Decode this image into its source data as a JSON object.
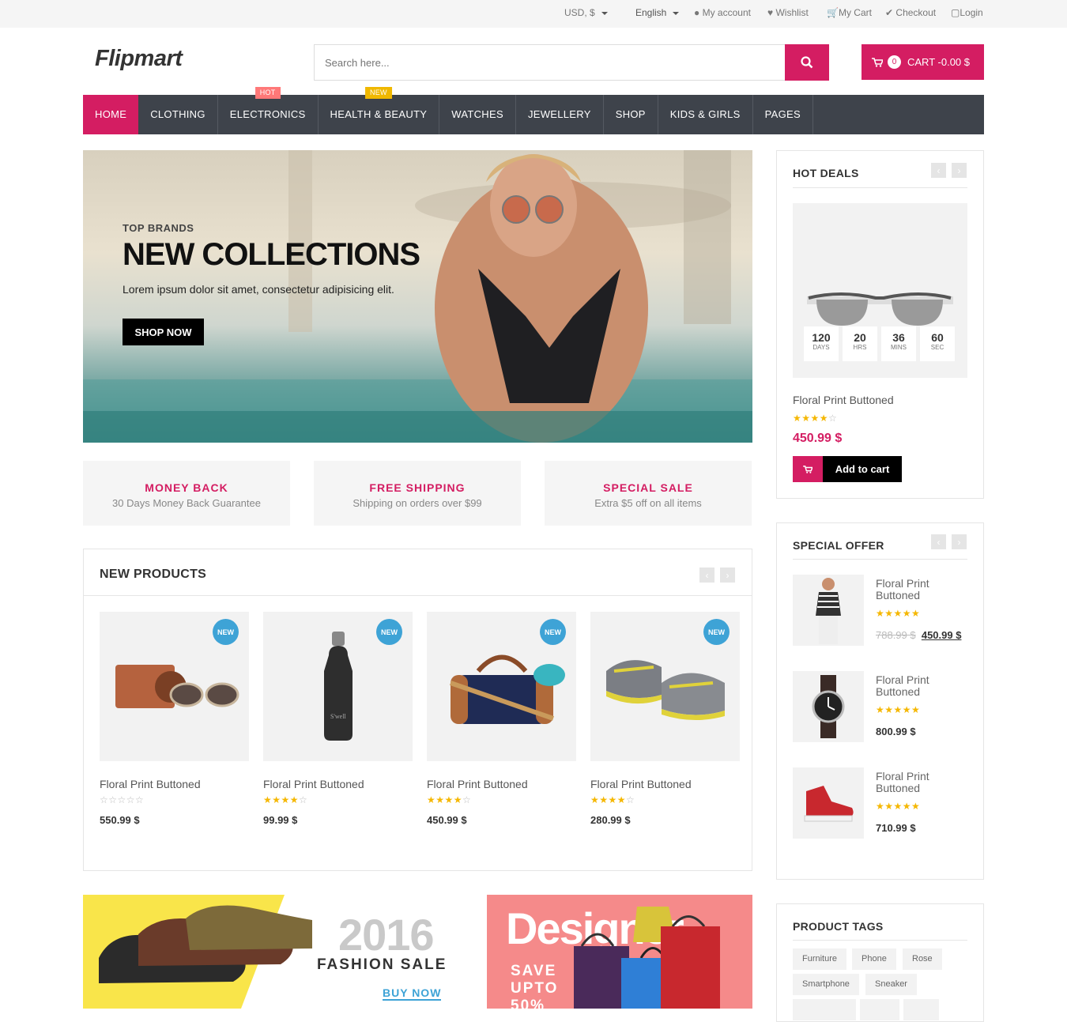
{
  "topbar": {
    "currency": "USD, $",
    "language": "English",
    "my_account": "My account",
    "wishlist": "Wishlist",
    "my_cart": "My Cart",
    "checkout": "Checkout",
    "login": "Login"
  },
  "header": {
    "logo": "Flipmart",
    "search_placeholder": "Search here...",
    "cart_count": "0",
    "cart_label": "CART -0.00 $"
  },
  "nav": {
    "items": [
      {
        "label": "HOME"
      },
      {
        "label": "CLOTHING"
      },
      {
        "label": "ELECTRONICS",
        "badge": "HOT"
      },
      {
        "label": "HEALTH & BEAUTY",
        "badge": "NEW"
      },
      {
        "label": "WATCHES"
      },
      {
        "label": "JEWELLERY"
      },
      {
        "label": "SHOP"
      },
      {
        "label": "KIDS & GIRLS"
      },
      {
        "label": "PAGES"
      }
    ]
  },
  "hero": {
    "kicker": "TOP BRANDS",
    "title": "NEW COLLECTIONS",
    "subtitle": "Lorem ipsum dolor sit amet, consectetur adipisicing elit.",
    "button": "SHOP NOW"
  },
  "features": [
    {
      "title": "MONEY BACK",
      "sub": "30 Days Money Back Guarantee"
    },
    {
      "title": "FREE SHIPPING",
      "sub": "Shipping on orders over $99"
    },
    {
      "title": "SPECIAL SALE",
      "sub": "Extra $5 off on all items"
    }
  ],
  "new_products": {
    "title": "NEW PRODUCTS",
    "badge": "NEW",
    "items": [
      {
        "name": "Floral Print Buttoned",
        "rating": 0,
        "price": "550.99 $"
      },
      {
        "name": "Floral Print Buttoned",
        "rating": 4,
        "price": "99.99 $"
      },
      {
        "name": "Floral Print Buttoned",
        "rating": 4,
        "price": "450.99 $"
      },
      {
        "name": "Floral Print Buttoned",
        "rating": 4,
        "price": "280.99 $"
      }
    ]
  },
  "hot_deals": {
    "title": "HOT DEALS",
    "countdown": [
      {
        "n": "120",
        "l": "DAYS"
      },
      {
        "n": "20",
        "l": "HRS"
      },
      {
        "n": "36",
        "l": "MINS"
      },
      {
        "n": "60",
        "l": "SEC"
      }
    ],
    "name": "Floral Print Buttoned",
    "rating": 4,
    "price": "450.99 $",
    "add_to_cart": "Add to cart"
  },
  "special_offer": {
    "title": "SPECIAL OFFER",
    "items": [
      {
        "name": "Floral Print Buttoned",
        "old_price": "788.99 $",
        "price": "450.99 $"
      },
      {
        "name": "Floral Print Buttoned",
        "price": "800.99 $"
      },
      {
        "name": "Floral Print Buttoned",
        "price": "710.99 $"
      }
    ]
  },
  "product_tags": {
    "title": "PRODUCT TAGS",
    "tags": [
      "Furniture",
      "Phone",
      "Rose",
      "Smartphone",
      "Sneaker"
    ]
  },
  "banners": {
    "left_year": "2016",
    "left_title": "FASHION SALE",
    "left_cta": "BUY NOW",
    "right_title": "Designer",
    "right_save1": "SAVE",
    "right_save2": "UPTO",
    "right_save3": "50%"
  },
  "colors": {
    "accent": "#d41d62",
    "nav": "#3e434b",
    "new_badge": "#3ea3d6",
    "star": "#f5b700"
  }
}
